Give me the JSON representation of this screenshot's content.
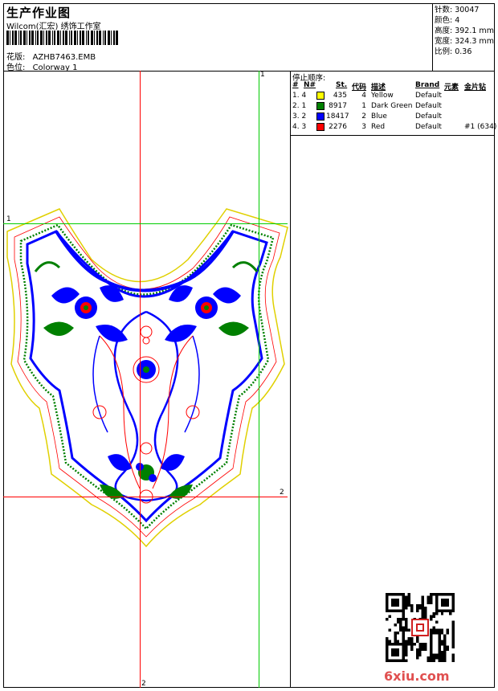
{
  "header": {
    "title": "生产作业图",
    "subtitle": "Wilcom(汇宏) 绣饰工作室",
    "design_label": "花版:",
    "design_value": "AZHB7463.EMB",
    "colorway_label": "色位:",
    "colorway_value": "Colorway 1"
  },
  "meta": {
    "stitches": "针数: 30047",
    "colors": "颜色: 4",
    "height": "高度: 392.1 mm",
    "width": "宽度: 324.3 mm",
    "scale": "比例: 0.36"
  },
  "guides": {
    "label_1": "1",
    "label_2": "2"
  },
  "stop_sequence": {
    "title": "停止顺序:",
    "columns": {
      "hash": "#",
      "n": "N#",
      "st": "St.",
      "code": "代码",
      "desc": "描述",
      "brand": "Brand",
      "element": "元素",
      "sequin": "金片钻"
    },
    "rows": [
      {
        "idx": "1. 4",
        "color": "#ffff00",
        "st": "435",
        "code": "4",
        "desc": "Yellow",
        "brand": "Default",
        "extra": ""
      },
      {
        "idx": "2. 1",
        "color": "#008000",
        "st": "8917",
        "code": "1",
        "desc": "Dark Green",
        "brand": "Default",
        "extra": ""
      },
      {
        "idx": "3. 2",
        "color": "#0000ff",
        "st": "18417",
        "code": "2",
        "desc": "Blue",
        "brand": "Default",
        "extra": ""
      },
      {
        "idx": "4. 3",
        "color": "#ff0000",
        "st": "2276",
        "code": "3",
        "desc": "Red",
        "brand": "Default",
        "extra": "#1 (634)"
      }
    ]
  },
  "watermark": {
    "site": "6xiu.com"
  },
  "colors": {
    "blue": "#0000ff",
    "green": "#008000",
    "red": "#ff0000",
    "yellow": "#ffff00",
    "guide_green": "#00cc00"
  }
}
